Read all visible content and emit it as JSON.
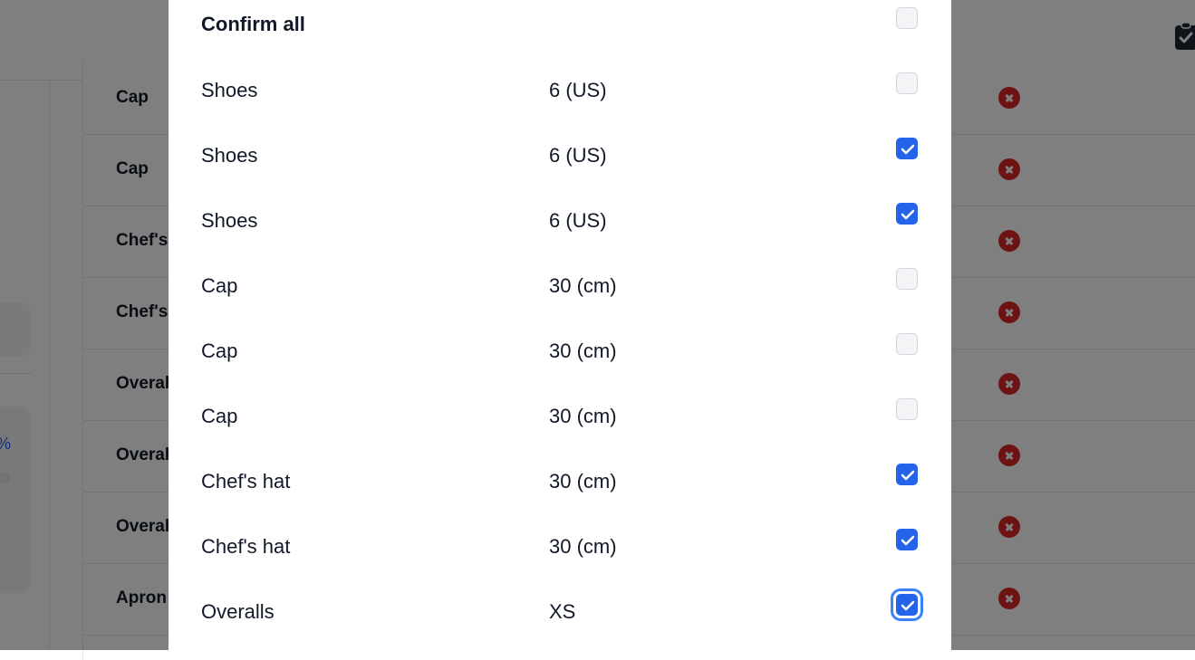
{
  "background": {
    "sidebar_progress_text": "%",
    "table_rows": [
      {
        "label": "Cap"
      },
      {
        "label": "Cap"
      },
      {
        "label": "Chef's hat"
      },
      {
        "label": "Chef's hat"
      },
      {
        "label": "Overalls"
      },
      {
        "label": "Overalls"
      },
      {
        "label": "Overalls"
      },
      {
        "label": "Apron"
      }
    ]
  },
  "modal": {
    "confirm_all": {
      "label": "Confirm all",
      "checked": false
    },
    "rows": [
      {
        "item": "Shoes",
        "size": "6 (US)",
        "checked": false
      },
      {
        "item": "Shoes",
        "size": "6 (US)",
        "checked": true
      },
      {
        "item": "Shoes",
        "size": "6 (US)",
        "checked": true
      },
      {
        "item": "Cap",
        "size": "30 (cm)",
        "checked": false
      },
      {
        "item": "Cap",
        "size": "30 (cm)",
        "checked": false
      },
      {
        "item": "Cap",
        "size": "30 (cm)",
        "checked": false
      },
      {
        "item": "Chef's hat",
        "size": "30 (cm)",
        "checked": true
      },
      {
        "item": "Chef's hat",
        "size": "30 (cm)",
        "checked": true
      },
      {
        "item": "Overalls",
        "size": "XS",
        "checked": true,
        "focused": true
      }
    ]
  },
  "colors": {
    "accent": "#2563eb",
    "danger": "#dc2626",
    "overlay": "rgba(0,0,0,0.5)"
  }
}
